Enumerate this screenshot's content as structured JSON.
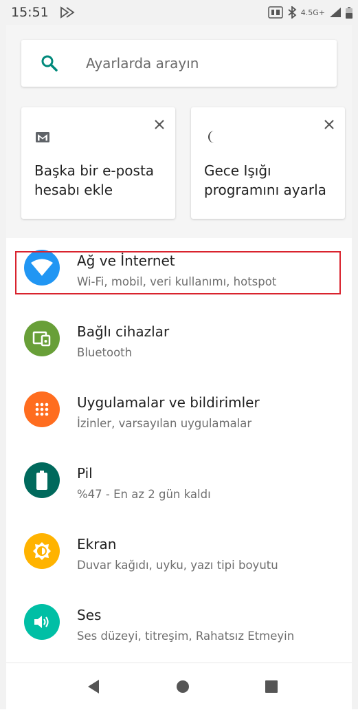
{
  "status_bar": {
    "time": "15:51",
    "network_label": "4.5G+"
  },
  "search": {
    "placeholder": "Ayarlarda arayın"
  },
  "suggestions": [
    {
      "icon": "gmail-icon",
      "text": "Başka bir e-posta hesabı ekle"
    },
    {
      "icon": "night-light-moon-icon",
      "text": "Gece Işığı programını ayarla"
    }
  ],
  "settings": [
    {
      "title": "Ağ ve İnternet",
      "subtitle": "Wi-Fi, mobil, veri kullanımı, hotspot",
      "icon": "wifi-icon",
      "color": "#2196f3"
    },
    {
      "title": "Bağlı cihazlar",
      "subtitle": "Bluetooth",
      "icon": "connected-devices-icon",
      "color": "#689f38"
    },
    {
      "title": "Uygulamalar ve bildirimler",
      "subtitle": "İzinler, varsayılan uygulamalar",
      "icon": "apps-grid-icon",
      "color": "#ff6d1f"
    },
    {
      "title": "Pil",
      "subtitle": "%47 - En az 2 gün kaldı",
      "icon": "battery-icon",
      "color": "#00695c"
    },
    {
      "title": "Ekran",
      "subtitle": "Duvar kağıdı, uyku, yazı tipi boyutu",
      "icon": "brightness-icon",
      "color": "#ffb300"
    },
    {
      "title": "Ses",
      "subtitle": "Ses düzeyi, titreşim, Rahatsız Etmeyin",
      "icon": "volume-icon",
      "color": "#00bfa5"
    }
  ],
  "colors": {
    "accent": "#00897b",
    "highlight": "#d9232e"
  }
}
